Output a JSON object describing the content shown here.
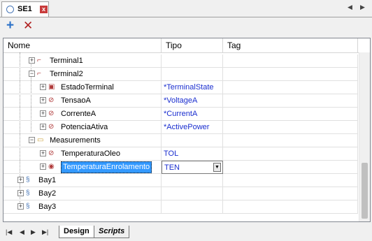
{
  "tab": {
    "title": "SE1",
    "close": "x"
  },
  "toolbar": {
    "add": "+",
    "delete": "✕"
  },
  "columns": {
    "name": "Nome",
    "type": "Tipo",
    "tag": "Tag"
  },
  "rows": [
    {
      "label": "Terminal1",
      "type": "",
      "level": 2,
      "expander": "+",
      "icon": "terminal-icon"
    },
    {
      "label": "Terminal2",
      "type": "",
      "level": 2,
      "expander": "−",
      "icon": "terminal-icon"
    },
    {
      "label": "EstadoTerminal",
      "type": "*TerminalState",
      "level": 3,
      "expander": "+",
      "icon": "digital-signal-icon"
    },
    {
      "label": "TensaoA",
      "type": "*VoltageA",
      "level": 3,
      "expander": "+",
      "icon": "analog-signal-icon"
    },
    {
      "label": "CorrenteA",
      "type": "*CurrentA",
      "level": 3,
      "expander": "+",
      "icon": "analog-signal-icon"
    },
    {
      "label": "PotenciaAtiva",
      "type": "*ActivePower",
      "level": 3,
      "expander": "+",
      "icon": "analog-signal-icon"
    },
    {
      "label": "Measurements",
      "type": "",
      "level": 2,
      "expander": "−",
      "icon": "folder-icon"
    },
    {
      "label": "TemperaturaOleo",
      "type": "TOL",
      "level": 3,
      "expander": "+",
      "icon": "analog-signal-icon"
    },
    {
      "label": "TemperaturaEnrolamento",
      "type": "TEN",
      "level": 3,
      "expander": "+",
      "icon": "globe-signal-icon"
    },
    {
      "label": "Bay1",
      "type": "",
      "level": 1,
      "expander": "+",
      "icon": "bay-icon"
    },
    {
      "label": "Bay2",
      "type": "",
      "level": 1,
      "expander": "+",
      "icon": "bay-icon"
    },
    {
      "label": "Bay3",
      "type": "",
      "level": 1,
      "expander": "+",
      "icon": "bay-icon"
    }
  ],
  "bottom_tabs": {
    "design": "Design",
    "scripts": "Scripts"
  }
}
